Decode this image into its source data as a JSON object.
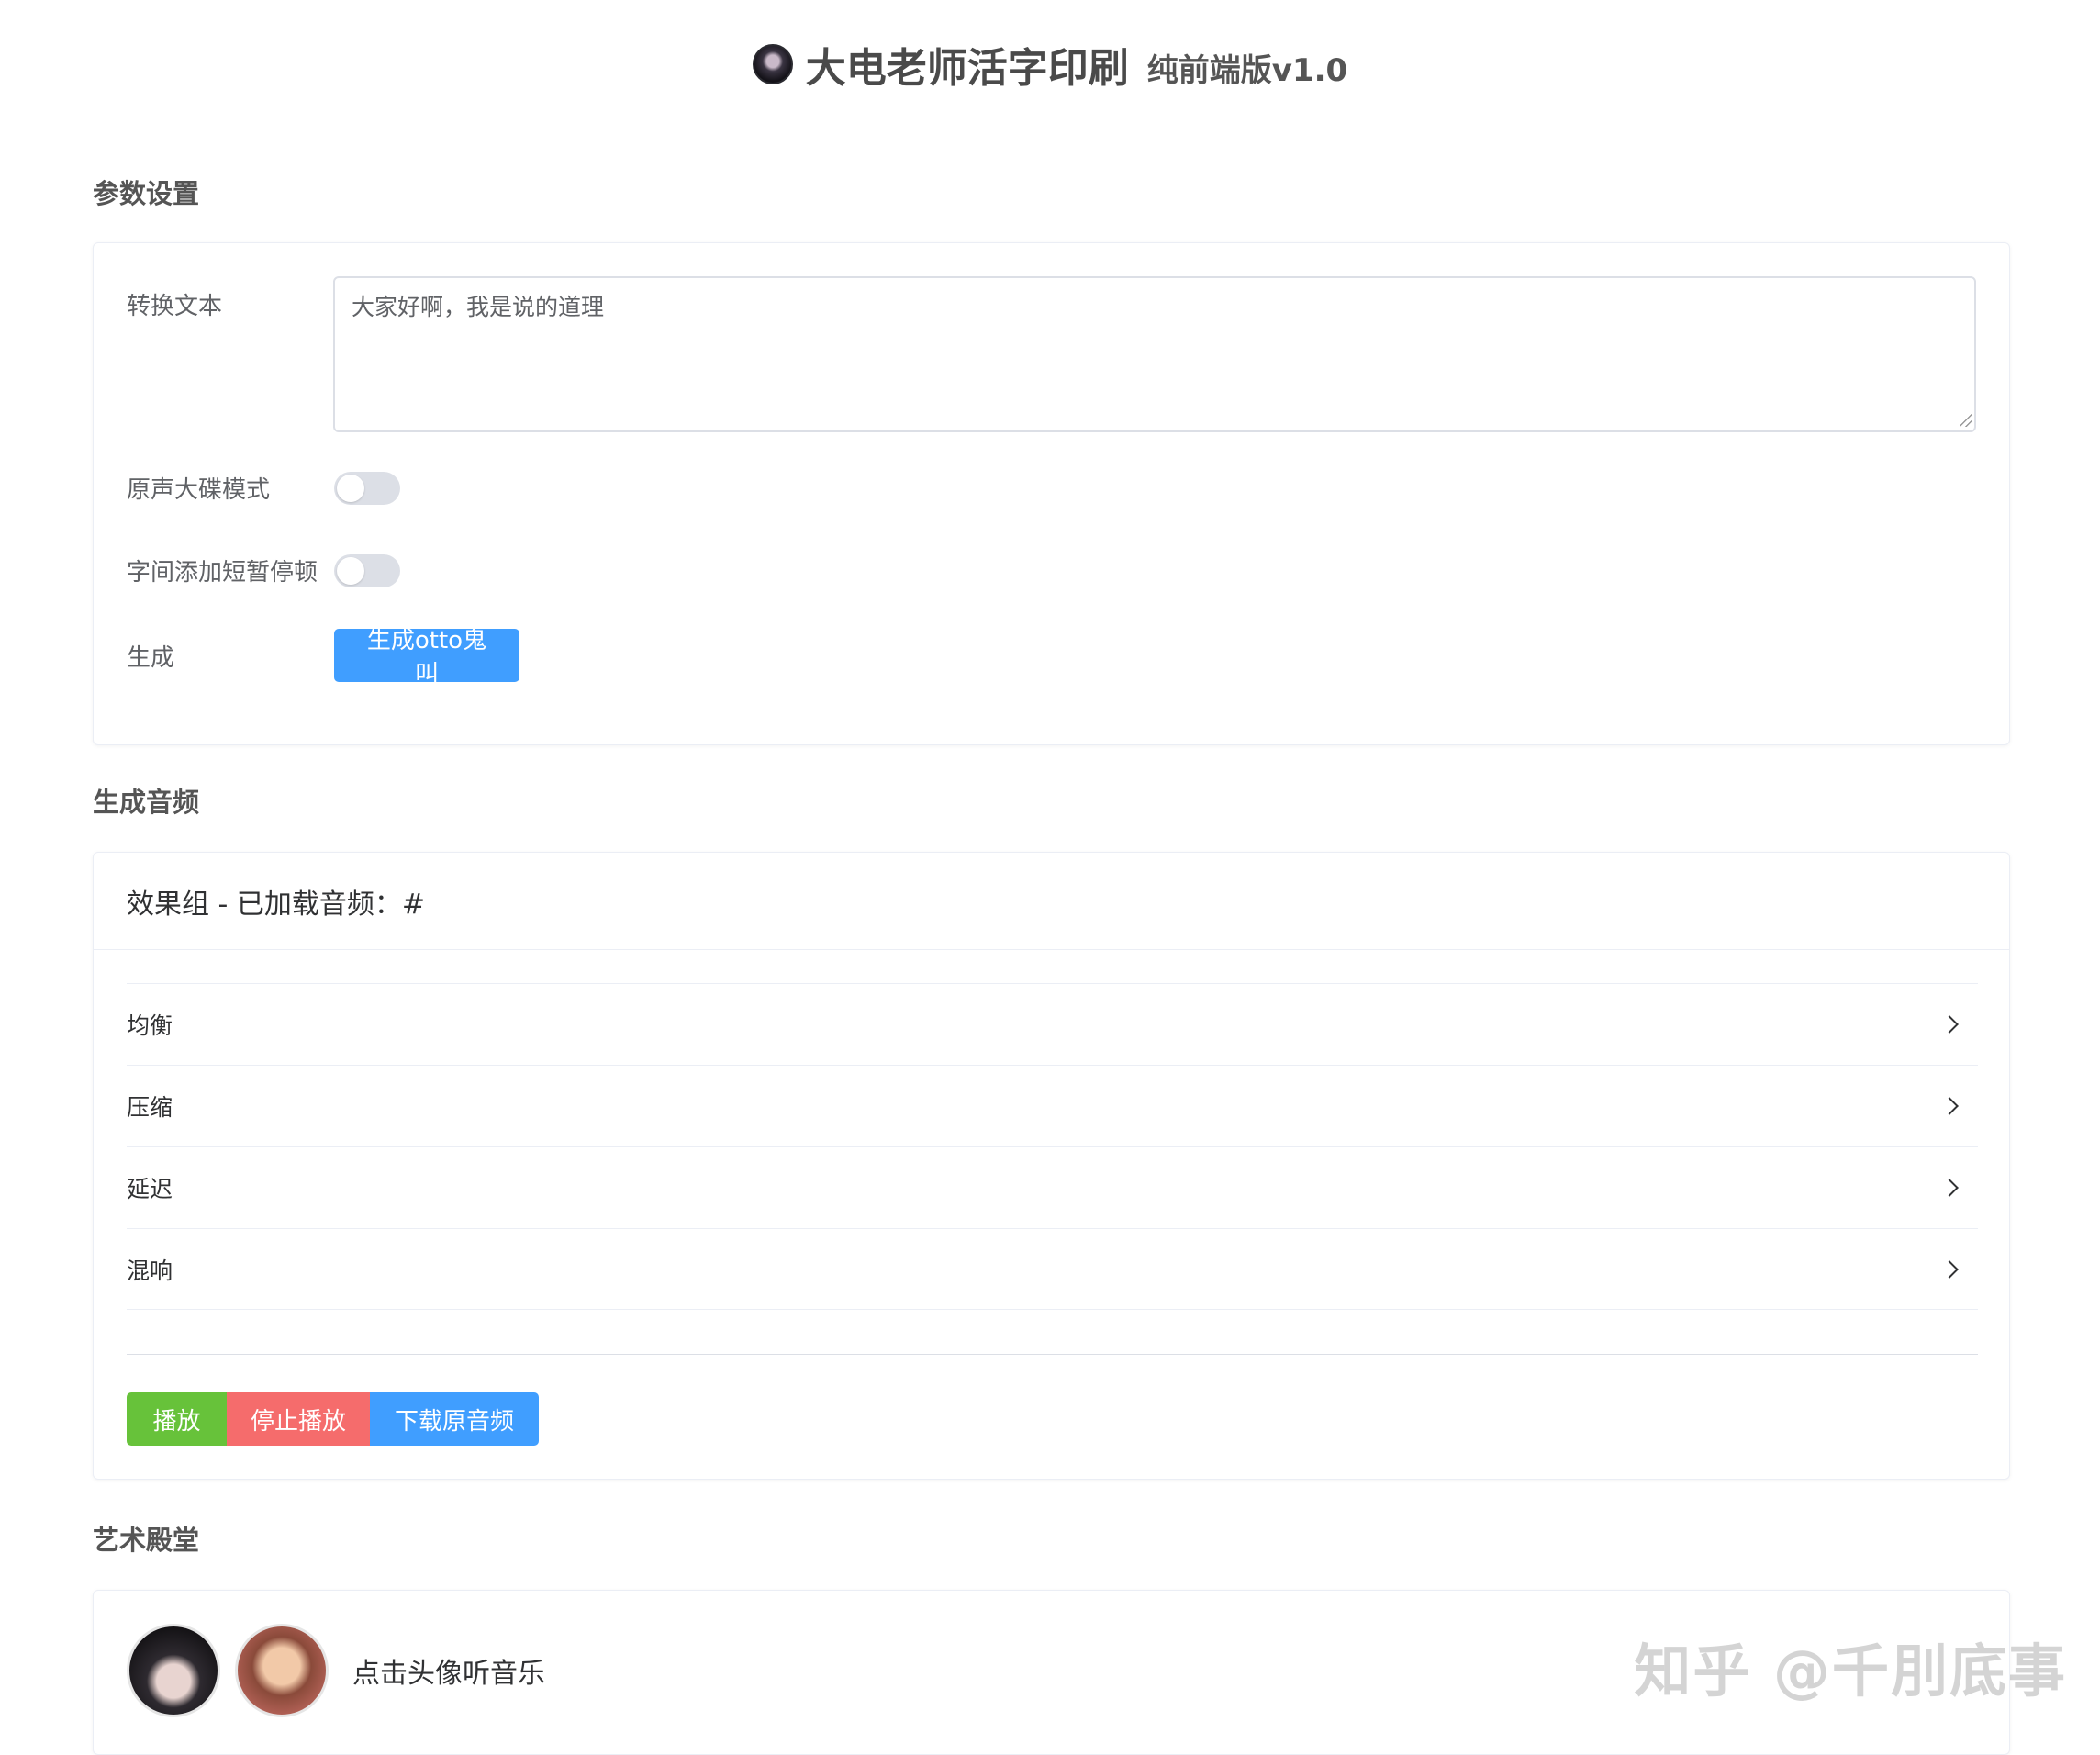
{
  "header": {
    "title": "大电老师活字印刷",
    "version": "纯前端版v1.0"
  },
  "params": {
    "section_title": "参数设置",
    "text_label": "转换文本",
    "text_value": "大家好啊，我是说的道理",
    "original_mode_label": "原声大碟模式",
    "original_mode_on": false,
    "pause_label": "字间添加短暂停顿",
    "pause_on": false,
    "generate_label": "生成",
    "generate_button": "生成otto鬼叫"
  },
  "audio": {
    "section_title": "生成音频",
    "effects_header": "效果组 - 已加载音频：#",
    "effects": [
      {
        "label": "均衡"
      },
      {
        "label": "压缩"
      },
      {
        "label": "延迟"
      },
      {
        "label": "混响"
      }
    ],
    "play_button": "播放",
    "stop_button": "停止播放",
    "download_button": "下载原音频"
  },
  "gallery": {
    "section_title": "艺术殿堂",
    "hint": "点击头像听音乐"
  },
  "watermark": "知乎 @千刖底事",
  "colors": {
    "primary": "#409eff",
    "success": "#67c23a",
    "danger": "#f56c6c"
  }
}
